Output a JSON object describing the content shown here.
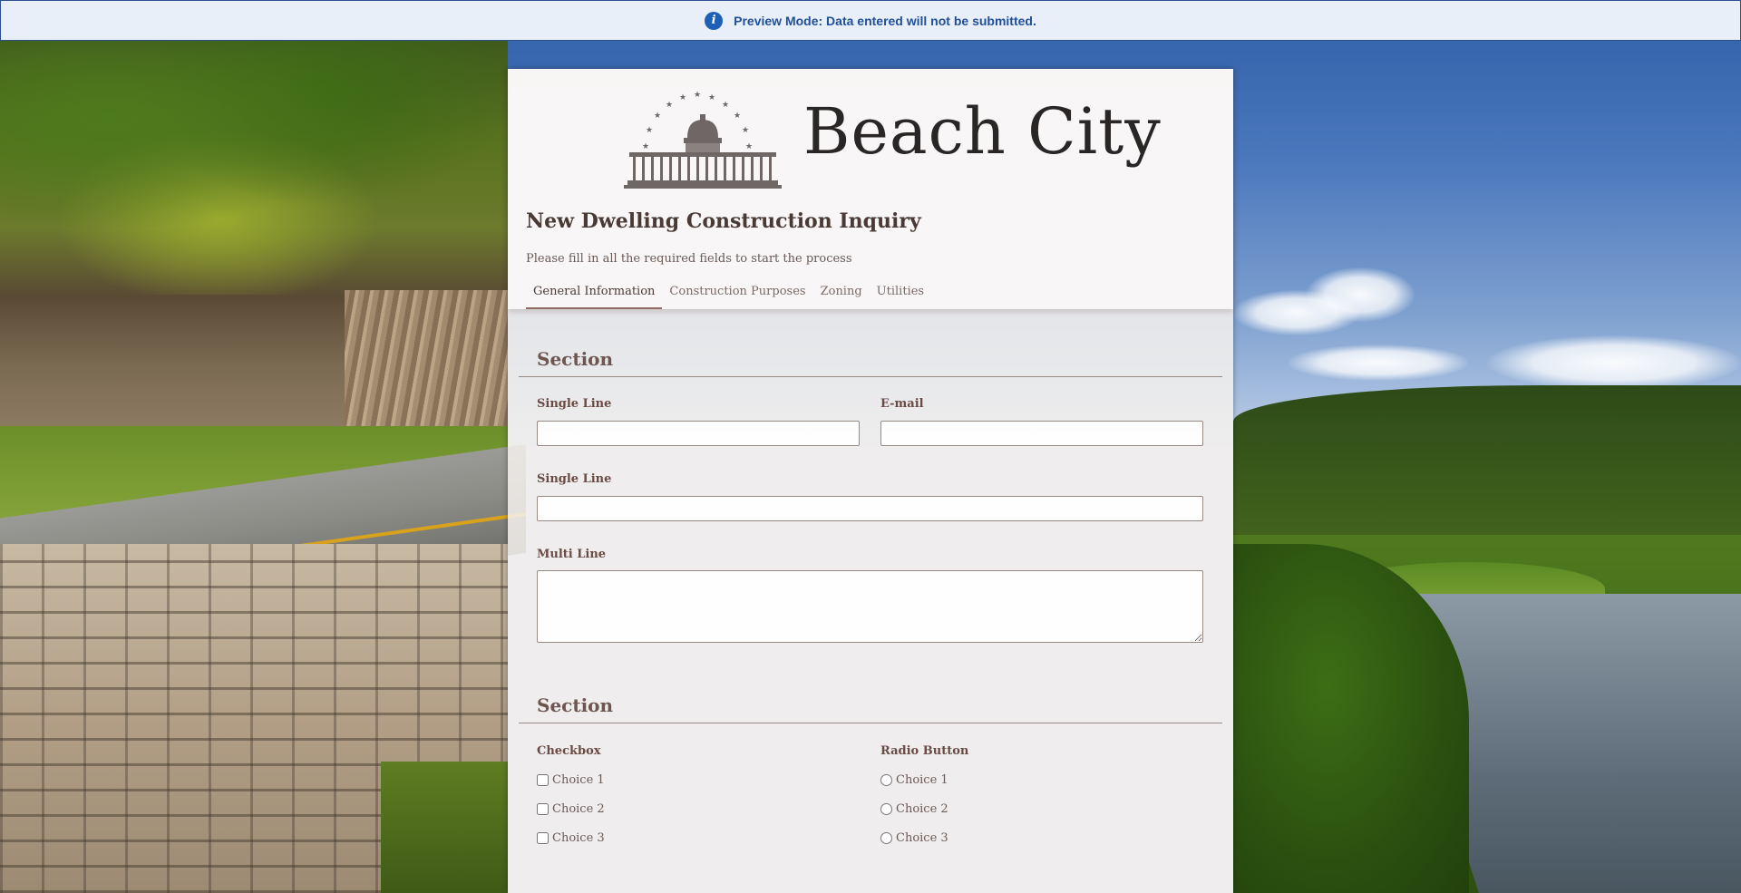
{
  "banner": {
    "icon": "info-icon",
    "text": "Preview Mode: Data entered will not be submitted."
  },
  "header": {
    "logo_text": "Beach City",
    "logo_icon": "capitol-building-icon",
    "title": "New Dwelling Construction Inquiry",
    "subtitle": "Please fill in all the required fields to start the process"
  },
  "tabs": [
    {
      "label": "General Information",
      "active": true
    },
    {
      "label": "Construction Purposes",
      "active": false
    },
    {
      "label": "Zoning",
      "active": false
    },
    {
      "label": "Utilities",
      "active": false
    }
  ],
  "sections": [
    {
      "title": "Section",
      "fields": [
        {
          "label": "Single Line",
          "value": "",
          "type": "text"
        },
        {
          "label": "E-mail",
          "value": "",
          "type": "email"
        },
        {
          "label": "Single Line",
          "value": "",
          "type": "text"
        },
        {
          "label": "Multi Line",
          "value": "",
          "type": "textarea"
        }
      ]
    },
    {
      "title": "Section",
      "checkbox": {
        "label": "Checkbox",
        "choices": [
          "Choice 1",
          "Choice 2",
          "Choice 3"
        ]
      },
      "radio": {
        "label": "Radio Button",
        "choices": [
          "Choice 1",
          "Choice 2",
          "Choice 3"
        ]
      }
    }
  ],
  "colors": {
    "banner_bg": "#e9eff8",
    "banner_text": "#1f4f9a",
    "title_text": "#4a3a36",
    "label_text": "#6a4a44",
    "active_tab_underline": "#8f6b63"
  }
}
